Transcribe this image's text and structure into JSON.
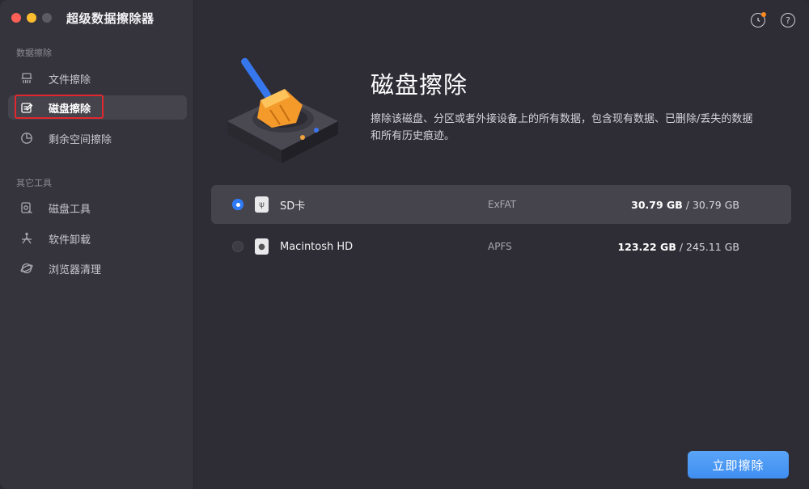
{
  "app": {
    "title": "超级数据擦除器"
  },
  "sidebar": {
    "section_erase": "数据擦除",
    "section_tools": "其它工具",
    "items": [
      {
        "label": "文件擦除",
        "icon": "shredder-icon"
      },
      {
        "label": "磁盘擦除",
        "icon": "disk-edit-icon",
        "active": true
      },
      {
        "label": "剩余空间擦除",
        "icon": "pie-chart-icon"
      },
      {
        "label": "磁盘工具",
        "icon": "disk-tool-icon"
      },
      {
        "label": "软件卸载",
        "icon": "uninstall-icon"
      },
      {
        "label": "浏览器清理",
        "icon": "browser-icon"
      }
    ]
  },
  "header_icons": {
    "history": "history-icon",
    "help": "help-icon",
    "help_glyph": "?"
  },
  "main": {
    "title": "磁盘擦除",
    "description": "擦除该磁盘、分区或者外接设备上的所有数据，包含现有数据、已删除/丢失的数据和所有历史痕迹。"
  },
  "disks": [
    {
      "name": "SD卡",
      "fs": "ExFAT",
      "used": "30.79 GB",
      "total": " / 30.79 GB",
      "selected": true
    },
    {
      "name": "Macintosh HD",
      "fs": "APFS",
      "used": "123.22 GB",
      "total": " / 245.11 GB",
      "selected": false
    }
  ],
  "actions": {
    "erase_now": "立即擦除"
  },
  "colors": {
    "accent": "#3f8ef0",
    "highlight": "#e0282e"
  }
}
